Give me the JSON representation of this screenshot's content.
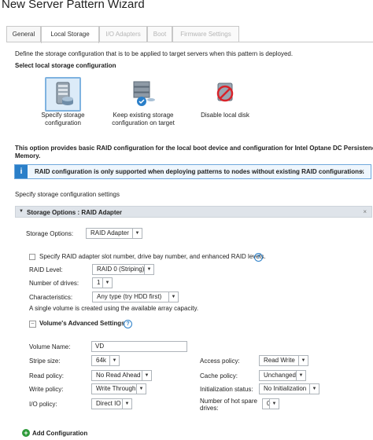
{
  "window": {
    "title": "New Server Pattern Wizard"
  },
  "tabs": [
    {
      "label": "General",
      "state": "normal"
    },
    {
      "label": "Local Storage",
      "state": "active"
    },
    {
      "label": "I/O Adapters",
      "state": "disabled"
    },
    {
      "label": "Boot",
      "state": "disabled"
    },
    {
      "label": "Firmware Settings",
      "state": "disabled"
    }
  ],
  "intro": "Define the storage configuration that is to be applied to target servers when this pattern is deployed.",
  "select_heading": "Select local storage configuration",
  "config_options": [
    {
      "line1": "Specify storage",
      "line2": "configuration",
      "icon": "server-storage-icon",
      "selected": true
    },
    {
      "line1": "Keep existing storage",
      "line2": "configuration on target",
      "icon": "server-check-icon",
      "selected": false
    },
    {
      "line1": "Disable local disk",
      "line2": "",
      "icon": "disk-disabled-icon",
      "selected": false
    }
  ],
  "option_desc": {
    "line1": "This option provides basic RAID configuration for the local boot device and configuration for Intel Optane DC Persistence",
    "line2": "Memory."
  },
  "info_banner": {
    "text": "RAID configuration is only supported when deploying patterns to nodes without existing RAID configurations.",
    "close": "×"
  },
  "specify_settings": "Specify storage configuration settings",
  "section": {
    "title": "Storage Options : RAID Adapter",
    "close": "×"
  },
  "storage_options": {
    "label": "Storage Options:",
    "value": "RAID Adapter"
  },
  "specify_raid_checkbox": "Specify RAID adapter slot number, drive bay number, and enhanced RAID levels.",
  "raid_level": {
    "label": "RAID Level:",
    "value": "RAID 0 (Striping)"
  },
  "num_drives": {
    "label": "Number of drives:",
    "value": "1"
  },
  "characteristics": {
    "label": "Characteristics:",
    "value": "Any type (try HDD first)"
  },
  "single_volume_note": "A single volume is created using the available array capacity.",
  "advanced": {
    "title": "Volume's Advanced Settings"
  },
  "volume_name": {
    "label": "Volume Name:",
    "value": "VD"
  },
  "stripe_size": {
    "label": "Stripe size:",
    "value": "64k"
  },
  "read_policy": {
    "label": "Read policy:",
    "value": "No Read Ahead"
  },
  "write_policy": {
    "label": "Write policy:",
    "value": "Write Through"
  },
  "io_policy": {
    "label": "I/O policy:",
    "value": "Direct IO"
  },
  "access_policy": {
    "label": "Access policy:",
    "value": "Read Write"
  },
  "cache_policy": {
    "label": "Cache policy:",
    "value": "Unchanged"
  },
  "init_status": {
    "label": "Initialization status:",
    "value": "No Initialization"
  },
  "hot_spare": {
    "label_line1": "Number of hot spare",
    "label_line2": "drives:",
    "value": "0"
  },
  "add_configuration": {
    "label": "Add Configuration",
    "icon": "plus-icon"
  },
  "colors": {
    "accent": "#2a7fc9",
    "add_green": "#2e9b3a",
    "section_bg": "#dfe4ea"
  }
}
